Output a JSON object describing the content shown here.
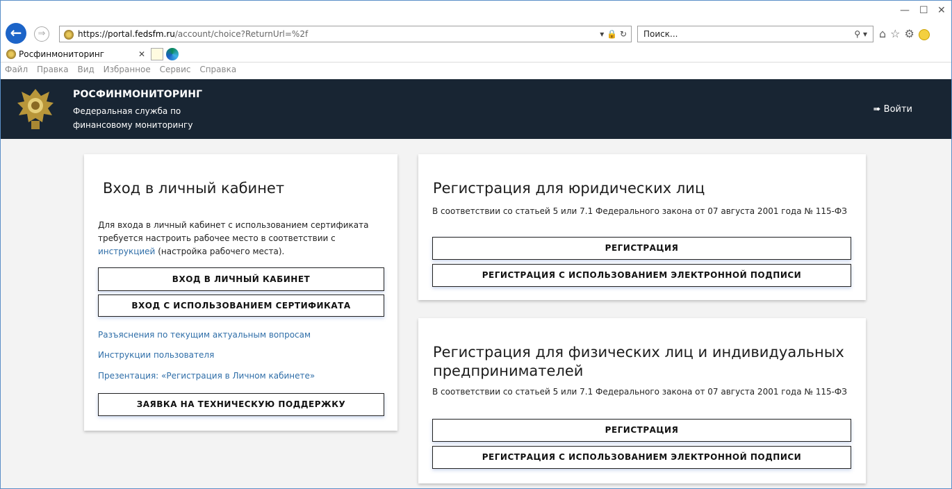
{
  "browser": {
    "url_host_prefix": "https://portal.",
    "url_host": "fedsfm.ru",
    "url_path": "/account/choice?ReturnUrl=%2f",
    "search_placeholder": "Поиск...",
    "tab_title": "Росфинмониторинг",
    "menu": [
      "Файл",
      "Правка",
      "Вид",
      "Избранное",
      "Сервис",
      "Справка"
    ],
    "icons": [
      "back-arrow-icon",
      "forward-arrow-icon",
      "lock-icon",
      "refresh-icon",
      "search-icon",
      "home-icon",
      "star-icon",
      "gear-icon",
      "smiley-icon"
    ]
  },
  "header": {
    "title": "РОСФИНМОНИТОРИНГ",
    "subtitle_line1": "Федеральная служба по",
    "subtitle_line2": "финансовому мониторингу",
    "login_label": "Войти",
    "bg_color": "#182533"
  },
  "login_card": {
    "title": "Вход в личный кабинет",
    "desc_before_link": "Для входа в личный кабинет с использованием сертификата требуется настроить рабочее место в соответствии с",
    "desc_link": "инструкцией",
    "desc_after_link": "(настройка рабочего места).",
    "btn_login": "ВХОД В ЛИЧНЫЙ КАБИНЕТ",
    "btn_cert": "ВХОД С ИСПОЛЬЗОВАНИЕМ СЕРТИФИКАТА",
    "links": [
      "Разъяснения по текущим актуальным вопросам",
      "Инструкции пользователя",
      "Презентация: «Регистрация в Личном кабинете»"
    ],
    "btn_support": "ЗАЯВКА НА ТЕХНИЧЕСКУЮ ПОДДЕРЖКУ"
  },
  "legal_card": {
    "title": "Регистрация для юридических лиц",
    "desc": "В соответствии со статьей 5 или 7.1 Федерального закона от 07 августа 2001 года № 115-ФЗ",
    "btn_register": "РЕГИСТРАЦИЯ",
    "btn_register_sign": "РЕГИСТРАЦИЯ С ИСПОЛЬЗОВАНИЕМ ЭЛЕКТРОННОЙ ПОДПИСИ"
  },
  "individual_card": {
    "title_line1": "Регистрация для физических лиц и индивидуальных",
    "title_line2": "предпринимателей",
    "desc": "В соответствии со статьей 5 или 7.1 Федерального закона от 07 августа 2001 года № 115-ФЗ",
    "btn_register": "РЕГИСТРАЦИЯ",
    "btn_register_sign": "РЕГИСТРАЦИЯ С ИСПОЛЬЗОВАНИЕМ ЭЛЕКТРОННОЙ ПОДПИСИ"
  }
}
